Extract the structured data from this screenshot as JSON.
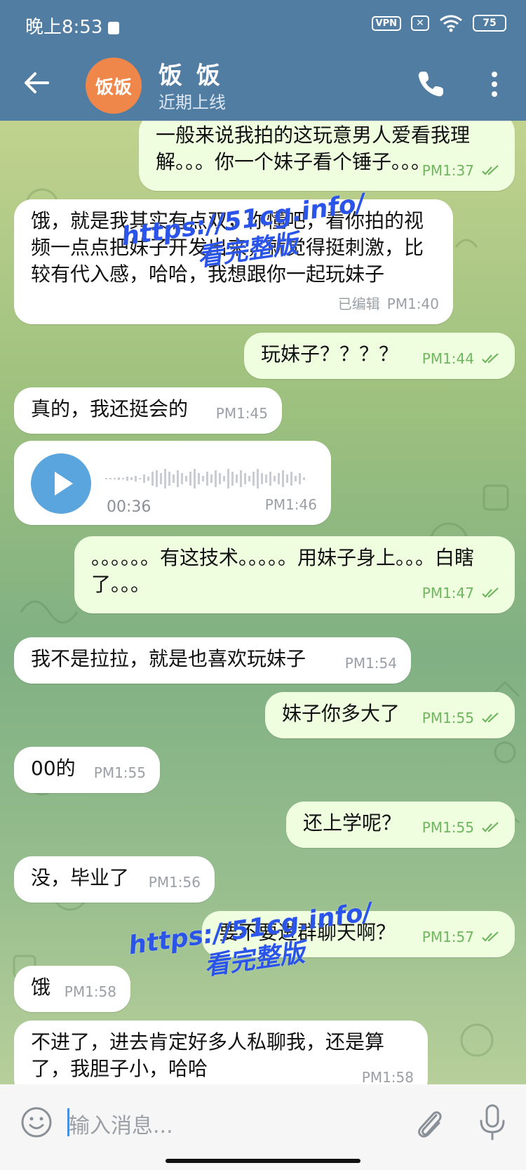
{
  "status_bar": {
    "time": "晚上8:53",
    "vpn": "VPN",
    "battery": "75"
  },
  "header": {
    "avatar_text": "饭饭",
    "name": "饭 饭",
    "status": "近期上线"
  },
  "messages": [
    {
      "dir": "out",
      "text": "一般来说我拍的这玩意男人爱看我理解。。。你一个妹子看个锤子。。。",
      "time": "PM1:37"
    },
    {
      "dir": "in",
      "text": "饿，就是我其实有点双，你懂吧，看你拍的视频一点点把妹子开发出来，就觉得挺刺激，比较有代入感，哈哈，我想跟你一起玩妹子",
      "time": "PM1:40",
      "edited": "已编辑"
    },
    {
      "dir": "out",
      "text": "玩妹子？？？？",
      "time": "PM1:44"
    },
    {
      "dir": "in",
      "text": "真的，我还挺会的",
      "time": "PM1:45"
    },
    {
      "dir": "in",
      "type": "voice",
      "duration": "00:36",
      "time": "PM1:46"
    },
    {
      "dir": "out",
      "text": "。。。。。。有这技术。。。。。用妹子身上。。。白瞎了。。。",
      "time": "PM1:47"
    },
    {
      "dir": "in",
      "text": "我不是拉拉，就是也喜欢玩妹子",
      "time": "PM1:54"
    },
    {
      "dir": "out",
      "text": "妹子你多大了",
      "time": "PM1:55"
    },
    {
      "dir": "in",
      "text": "00的",
      "time": "PM1:55"
    },
    {
      "dir": "out",
      "text": "还上学呢？",
      "time": "PM1:55"
    },
    {
      "dir": "in",
      "text": "没，毕业了",
      "time": "PM1:56"
    },
    {
      "dir": "out",
      "text": "要不要进群聊天啊？",
      "time": "PM1:57"
    },
    {
      "dir": "in",
      "text": "饿",
      "time": "PM1:58"
    },
    {
      "dir": "in",
      "text": "不进了，进去肯定好多人私聊我，还是算了，我胆子小，哈哈",
      "time": "PM1:58"
    }
  ],
  "watermarks": [
    {
      "url": "https://51cg.info/",
      "caption": "看完整版"
    },
    {
      "url": "https://51cg.info/",
      "caption": "看完整版"
    }
  ],
  "input": {
    "placeholder": "输入消息..."
  },
  "colors": {
    "header": "#527da3",
    "incoming": "#ffffff",
    "outgoing": "#eefedf",
    "watermark": "#2b55e8",
    "avatar": "#f0874a"
  }
}
